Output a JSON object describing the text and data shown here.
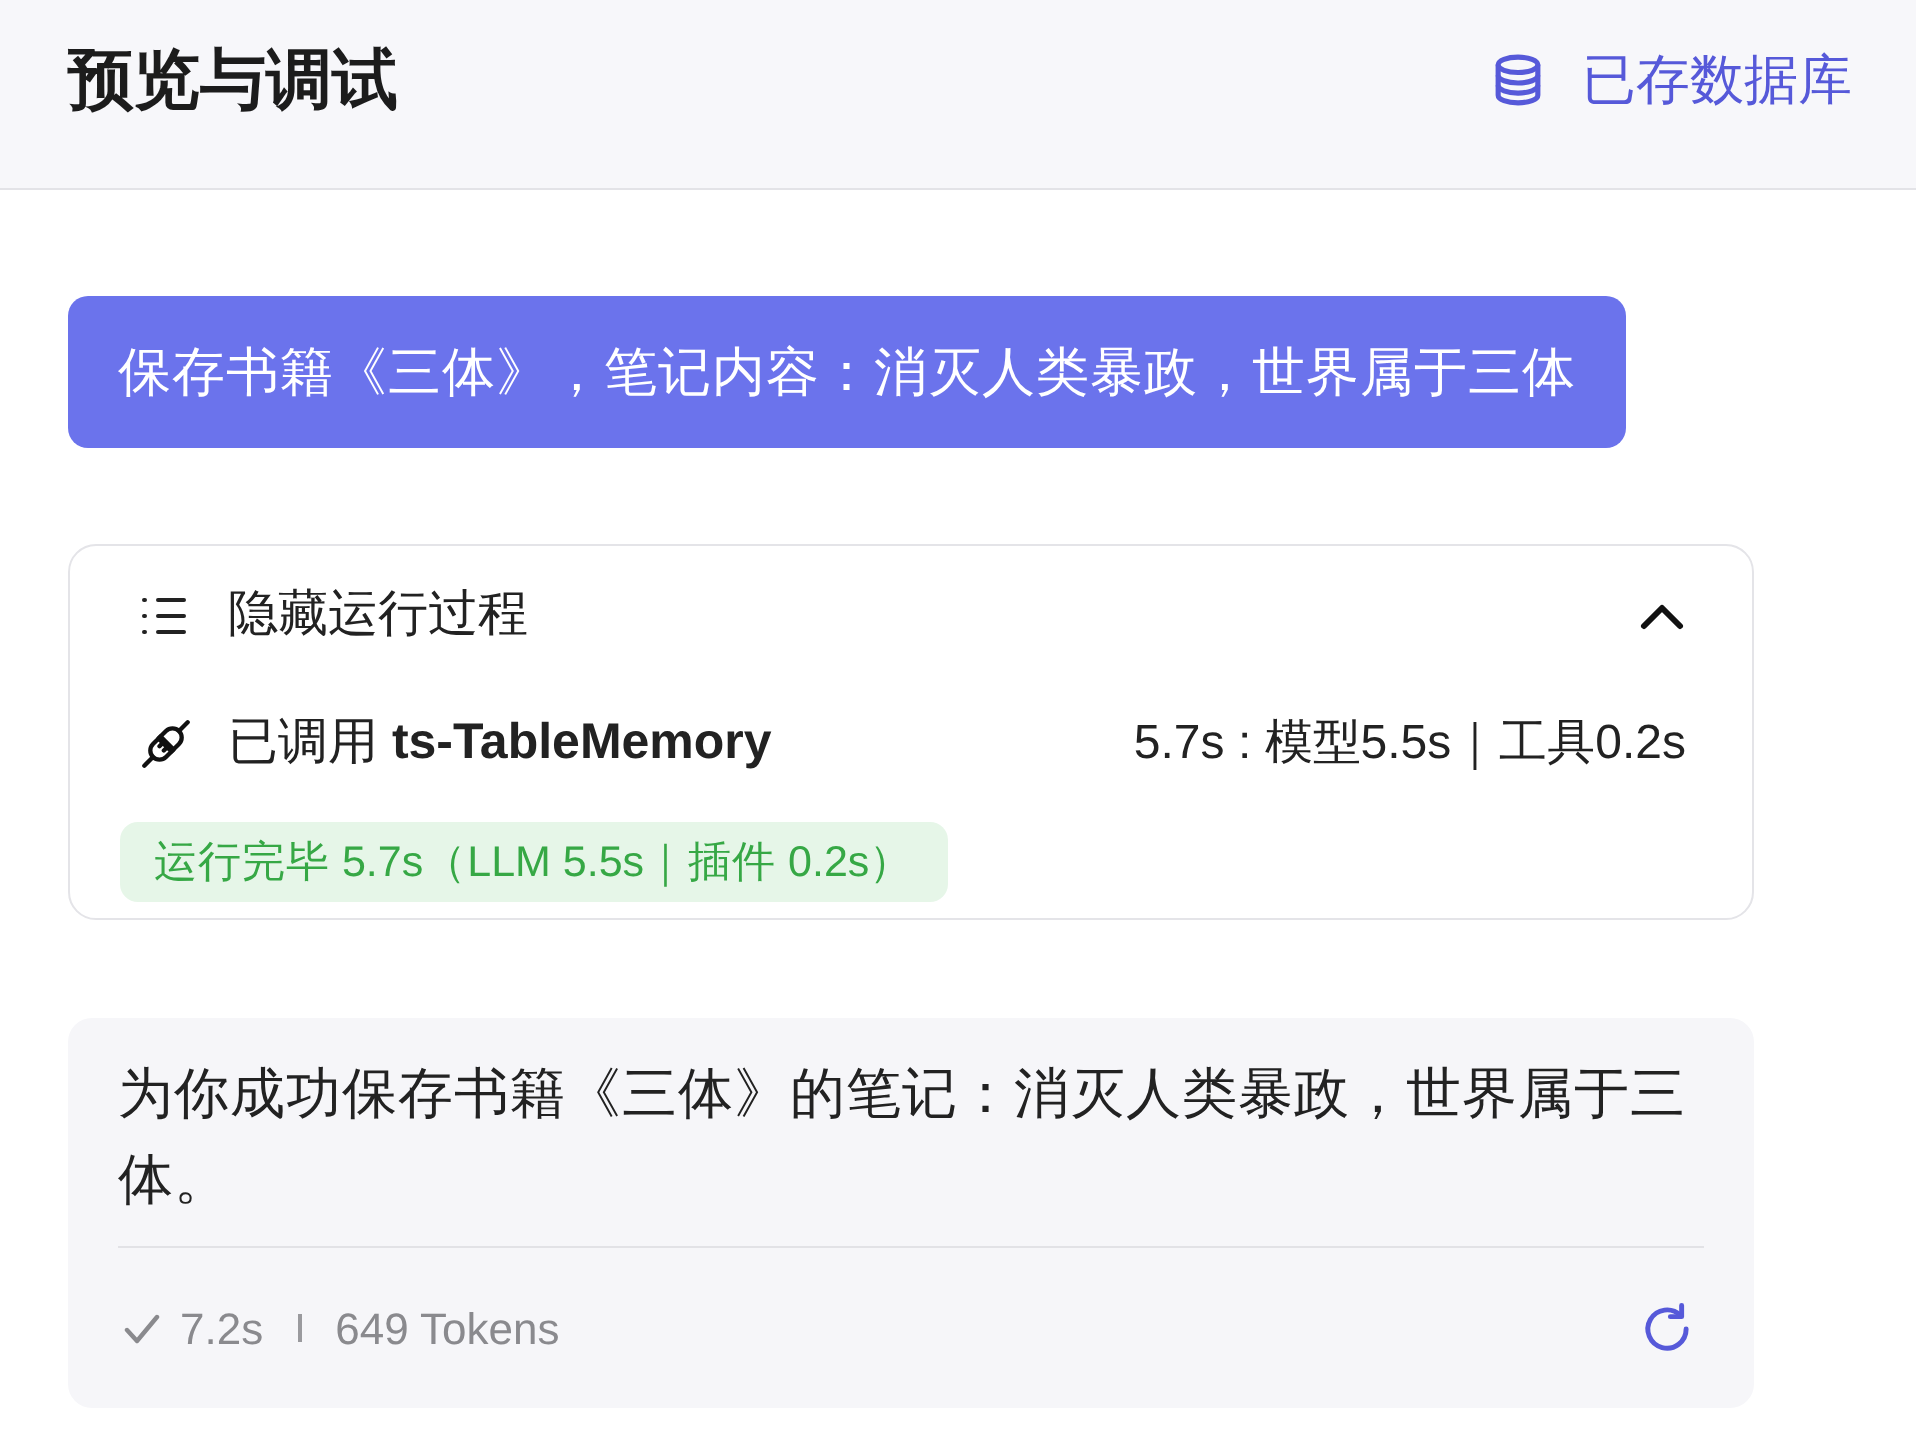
{
  "header": {
    "title": "预览与调试",
    "database_link": "已存数据库"
  },
  "user_message": "保存书籍《三体》，笔记内容：消灭人类暴政，世界属于三体",
  "process": {
    "toggle_label": "隐藏运行过程",
    "expanded": true,
    "tool_call": {
      "label": "已调用 **ts-TableMemory**",
      "timing": "5.7s : 模型5.5s｜工具0.2s"
    },
    "status": "运行完毕 5.7s（LLM 5.5s｜插件 0.2s）"
  },
  "response": {
    "text": "为你成功保存书籍《三体》的笔记：消灭人类暴政，世界属于三体。",
    "duration": "7.2s",
    "tokens": "649 Tokens"
  }
}
